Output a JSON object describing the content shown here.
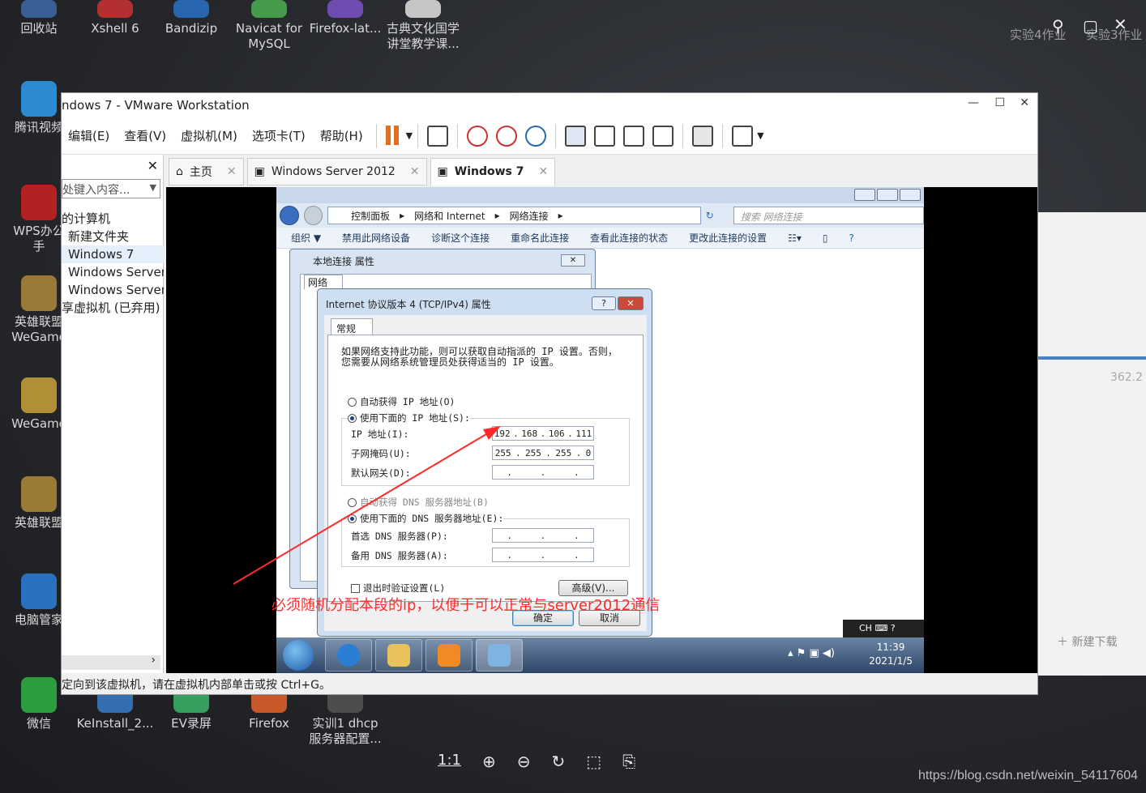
{
  "desktop": {
    "row1": [
      "回收站",
      "Xshell 6",
      "Bandizip",
      "Navicat for\nMySQL",
      "Firefox-lat...",
      "古典文化国学\n讲堂教学课..."
    ],
    "left_column": [
      "腾讯视频",
      "WPS办公\n手",
      "英雄联盟\nWeGame",
      "WeGame",
      "英雄联盟",
      "电脑管家"
    ],
    "bottom_row": [
      "微信",
      "KeInstall_2...",
      "EV录屏",
      "Firefox",
      "实训1 dhcp\n服务器配置..."
    ],
    "top_right": [
      "实验4作业",
      "实验3作业"
    ],
    "right_app": {
      "number": "362.2",
      "download": "新建下载"
    }
  },
  "vmware": {
    "title": "ndows 7 - VMware Workstation",
    "menu": [
      "编辑(E)",
      "查看(V)",
      "虚拟机(M)",
      "选项卡(T)",
      "帮助(H)"
    ],
    "library": {
      "search_placeholder": "处键入内容...",
      "tree": [
        "的计算机",
        "新建文件夹",
        "Windows 7",
        "Windows Server",
        "Windows Server",
        "享虚拟机 (已弃用)"
      ]
    },
    "tabs": [
      {
        "label": "主页"
      },
      {
        "label": "Windows Server 2012"
      },
      {
        "label": "Windows 7"
      }
    ],
    "status": "定向到该虚拟机，请在虚拟机内部单击或按 Ctrl+G。"
  },
  "explorer": {
    "breadcrumb": [
      "控制面板",
      "网络和 Internet",
      "网络连接"
    ],
    "search_placeholder": "搜索 网络连接",
    "commands": [
      "组织 ▼",
      "禁用此网络设备",
      "诊断这个连接",
      "重命名此连接",
      "查看此连接的状态",
      "更改此连接的设置"
    ]
  },
  "lan_dialog": {
    "title": "本地连接 属性",
    "tab": "网络"
  },
  "ipv4_dialog": {
    "title": "Internet 协议版本 4 (TCP/IPv4) 属性",
    "tab": "常规",
    "description_l1": "如果网络支持此功能，则可以获取自动指派的 IP 设置。否则，",
    "description_l2": "您需要从网络系统管理员处获得适当的 IP 设置。",
    "auto_ip": "自动获得 IP 地址(O)",
    "manual_ip": "使用下面的 IP 地址(S):",
    "ip_label": "IP 地址(I):",
    "ip": [
      "192",
      "168",
      "106",
      "111"
    ],
    "mask_label": "子网掩码(U):",
    "mask": [
      "255",
      "255",
      "255",
      "0"
    ],
    "gateway_label": "默认网关(D):",
    "auto_dns": "自动获得 DNS 服务器地址(B)",
    "manual_dns": "使用下面的 DNS 服务器地址(E):",
    "dns1_label": "首选 DNS 服务器(P):",
    "dns2_label": "备用 DNS 服务器(A):",
    "validate": "退出时验证设置(L)",
    "advanced": "高级(V)...",
    "ok": "确定",
    "cancel": "取消"
  },
  "guest_taskbar": {
    "time": "11:39",
    "date": "2021/1/5",
    "lang": "CH"
  },
  "annotation": {
    "text": "必须随机分配本段的ip，以便于可以正常与server2012通信",
    "color": "#ff2b2b"
  },
  "viewer": {
    "ratio": "1:1"
  },
  "watermark": "https://blog.csdn.net/weixin_54117604"
}
